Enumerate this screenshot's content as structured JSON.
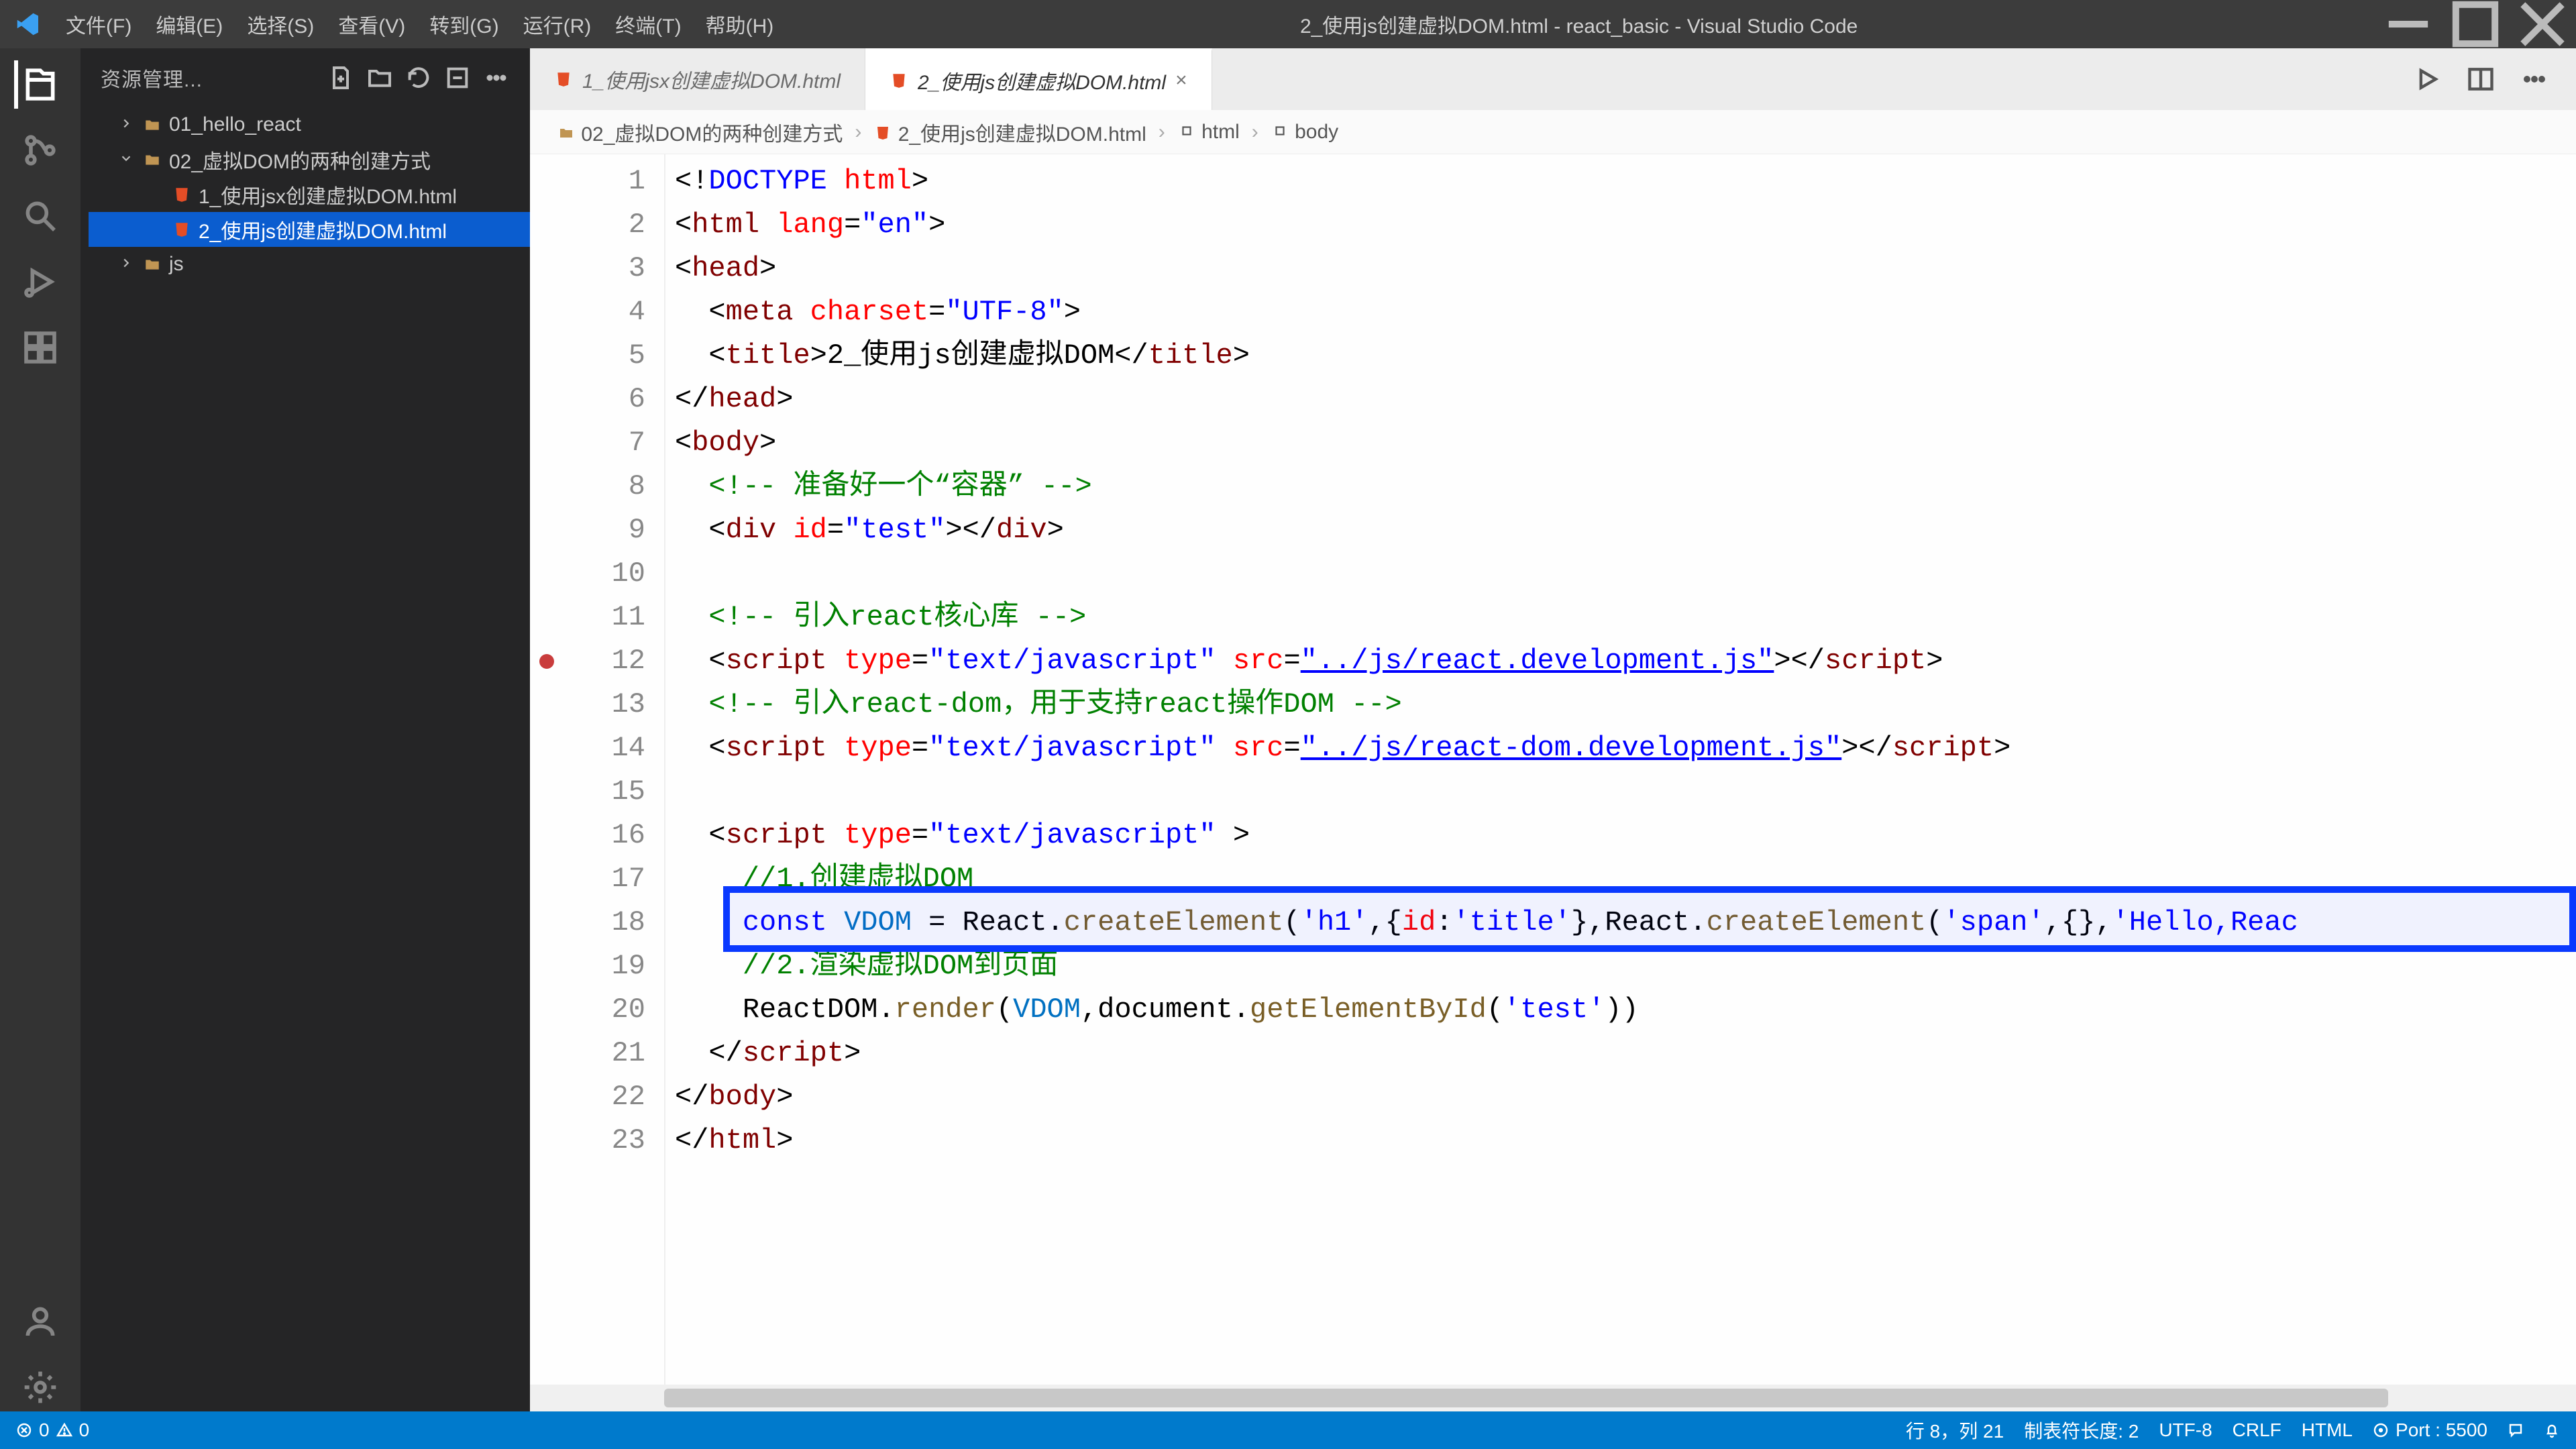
{
  "title": "2_使用js创建虚拟DOM.html - react_basic - Visual Studio Code",
  "menu": {
    "file": "文件(F)",
    "edit": "编辑(E)",
    "select": "选择(S)",
    "view": "查看(V)",
    "goto": "转到(G)",
    "run": "运行(R)",
    "terminal": "终端(T)",
    "help": "帮助(H)"
  },
  "sidebar": {
    "title": "资源管理...",
    "tree": [
      {
        "label": "01_hello_react",
        "kind": "folder",
        "indent": 1,
        "expanded": false
      },
      {
        "label": "02_虚拟DOM的两种创建方式",
        "kind": "folder",
        "indent": 1,
        "expanded": true
      },
      {
        "label": "1_使用jsx创建虚拟DOM.html",
        "kind": "html",
        "indent": 2
      },
      {
        "label": "2_使用js创建虚拟DOM.html",
        "kind": "html",
        "indent": 2,
        "selected": true
      },
      {
        "label": "js",
        "kind": "folder",
        "indent": 1,
        "expanded": false
      }
    ]
  },
  "tabs": [
    {
      "label": "1_使用jsx创建虚拟DOM.html",
      "active": false
    },
    {
      "label": "2_使用js创建虚拟DOM.html",
      "active": true
    }
  ],
  "breadcrumbs": [
    "02_虚拟DOM的两种创建方式",
    "2_使用js创建虚拟DOM.html",
    "html",
    "body"
  ],
  "code": {
    "lines": [
      {
        "n": 1,
        "seg": [
          {
            "c": "txt",
            "t": "<!"
          },
          {
            "c": "kw",
            "t": "DOCTYPE"
          },
          {
            "c": "txt",
            "t": " "
          },
          {
            "c": "attr",
            "t": "html"
          },
          {
            "c": "txt",
            "t": ">"
          }
        ]
      },
      {
        "n": 2,
        "seg": [
          {
            "c": "txt",
            "t": "<"
          },
          {
            "c": "tag",
            "t": "html"
          },
          {
            "c": "txt",
            "t": " "
          },
          {
            "c": "attr",
            "t": "lang"
          },
          {
            "c": "txt",
            "t": "="
          },
          {
            "c": "str",
            "t": "\"en\""
          },
          {
            "c": "txt",
            "t": ">"
          }
        ]
      },
      {
        "n": 3,
        "seg": [
          {
            "c": "txt",
            "t": "<"
          },
          {
            "c": "tag",
            "t": "head"
          },
          {
            "c": "txt",
            "t": ">"
          }
        ]
      },
      {
        "n": 4,
        "seg": [
          {
            "c": "txt",
            "t": "  <"
          },
          {
            "c": "tag",
            "t": "meta"
          },
          {
            "c": "txt",
            "t": " "
          },
          {
            "c": "attr",
            "t": "charset"
          },
          {
            "c": "txt",
            "t": "="
          },
          {
            "c": "str",
            "t": "\"UTF-8\""
          },
          {
            "c": "txt",
            "t": ">"
          }
        ]
      },
      {
        "n": 5,
        "seg": [
          {
            "c": "txt",
            "t": "  <"
          },
          {
            "c": "tag",
            "t": "title"
          },
          {
            "c": "txt",
            "t": ">2_使用js创建虚拟DOM</"
          },
          {
            "c": "tag",
            "t": "title"
          },
          {
            "c": "txt",
            "t": ">"
          }
        ]
      },
      {
        "n": 6,
        "seg": [
          {
            "c": "txt",
            "t": "</"
          },
          {
            "c": "tag",
            "t": "head"
          },
          {
            "c": "txt",
            "t": ">"
          }
        ]
      },
      {
        "n": 7,
        "seg": [
          {
            "c": "txt",
            "t": "<"
          },
          {
            "c": "tag",
            "t": "body"
          },
          {
            "c": "txt",
            "t": ">"
          }
        ]
      },
      {
        "n": 8,
        "seg": [
          {
            "c": "cmt",
            "t": "  <!-- 准备好一个“容器” -->"
          }
        ]
      },
      {
        "n": 9,
        "seg": [
          {
            "c": "txt",
            "t": "  <"
          },
          {
            "c": "tag",
            "t": "div"
          },
          {
            "c": "txt",
            "t": " "
          },
          {
            "c": "attr",
            "t": "id"
          },
          {
            "c": "txt",
            "t": "="
          },
          {
            "c": "str",
            "t": "\"test\""
          },
          {
            "c": "txt",
            "t": "></"
          },
          {
            "c": "tag",
            "t": "div"
          },
          {
            "c": "txt",
            "t": ">"
          }
        ]
      },
      {
        "n": 10,
        "seg": [
          {
            "c": "txt",
            "t": ""
          }
        ]
      },
      {
        "n": 11,
        "seg": [
          {
            "c": "cmt",
            "t": "  <!-- 引入react核心库 -->"
          }
        ]
      },
      {
        "n": 12,
        "bp": true,
        "seg": [
          {
            "c": "txt",
            "t": "  <"
          },
          {
            "c": "tag",
            "t": "script"
          },
          {
            "c": "txt",
            "t": " "
          },
          {
            "c": "attr",
            "t": "type"
          },
          {
            "c": "txt",
            "t": "="
          },
          {
            "c": "str",
            "t": "\"text/javascript\""
          },
          {
            "c": "txt",
            "t": " "
          },
          {
            "c": "attr",
            "t": "src"
          },
          {
            "c": "txt",
            "t": "="
          },
          {
            "c": "str und",
            "t": "\"../js/react.development.js\""
          },
          {
            "c": "txt",
            "t": "></"
          },
          {
            "c": "tag",
            "t": "script"
          },
          {
            "c": "txt",
            "t": ">"
          }
        ]
      },
      {
        "n": 13,
        "seg": [
          {
            "c": "cmt",
            "t": "  <!-- 引入react-dom，用于支持react操作DOM -->"
          }
        ]
      },
      {
        "n": 14,
        "seg": [
          {
            "c": "txt",
            "t": "  <"
          },
          {
            "c": "tag",
            "t": "script"
          },
          {
            "c": "txt",
            "t": " "
          },
          {
            "c": "attr",
            "t": "type"
          },
          {
            "c": "txt",
            "t": "="
          },
          {
            "c": "str",
            "t": "\"text/javascript\""
          },
          {
            "c": "txt",
            "t": " "
          },
          {
            "c": "attr",
            "t": "src"
          },
          {
            "c": "txt",
            "t": "="
          },
          {
            "c": "str und",
            "t": "\"../js/react-dom.development.js\""
          },
          {
            "c": "txt",
            "t": "></"
          },
          {
            "c": "tag",
            "t": "script"
          },
          {
            "c": "txt",
            "t": ">"
          }
        ]
      },
      {
        "n": 15,
        "seg": [
          {
            "c": "txt",
            "t": ""
          }
        ]
      },
      {
        "n": 16,
        "seg": [
          {
            "c": "txt",
            "t": "  <"
          },
          {
            "c": "tag",
            "t": "script"
          },
          {
            "c": "txt",
            "t": " "
          },
          {
            "c": "attr",
            "t": "type"
          },
          {
            "c": "txt",
            "t": "="
          },
          {
            "c": "str",
            "t": "\"text/javascript\""
          },
          {
            "c": "txt",
            "t": " >"
          }
        ]
      },
      {
        "n": 17,
        "seg": [
          {
            "c": "cmt",
            "t": "    //1.创建虚拟DOM"
          }
        ]
      },
      {
        "n": 18,
        "hl": true,
        "seg": [
          {
            "c": "txt",
            "t": "    "
          },
          {
            "c": "kw",
            "t": "const"
          },
          {
            "c": "txt",
            "t": " "
          },
          {
            "c": "varc",
            "t": "VDOM"
          },
          {
            "c": "txt",
            "t": " = React."
          },
          {
            "c": "fn",
            "t": "createElement"
          },
          {
            "c": "txt",
            "t": "("
          },
          {
            "c": "str",
            "t": "'h1'"
          },
          {
            "c": "txt",
            "t": ",{"
          },
          {
            "c": "attr",
            "t": "id"
          },
          {
            "c": "txt",
            "t": ":"
          },
          {
            "c": "str",
            "t": "'title'"
          },
          {
            "c": "txt",
            "t": "},React."
          },
          {
            "c": "fn",
            "t": "createElement"
          },
          {
            "c": "txt",
            "t": "("
          },
          {
            "c": "str",
            "t": "'span'"
          },
          {
            "c": "txt",
            "t": ",{},"
          },
          {
            "c": "str",
            "t": "'Hello,Reac"
          }
        ]
      },
      {
        "n": 19,
        "seg": [
          {
            "c": "cmt",
            "t": "    //2.渲染虚拟DOM到页面"
          }
        ]
      },
      {
        "n": 20,
        "seg": [
          {
            "c": "txt",
            "t": "    ReactDOM."
          },
          {
            "c": "fn",
            "t": "render"
          },
          {
            "c": "txt",
            "t": "("
          },
          {
            "c": "varc",
            "t": "VDOM"
          },
          {
            "c": "txt",
            "t": ",document."
          },
          {
            "c": "fn",
            "t": "getElementById"
          },
          {
            "c": "txt",
            "t": "("
          },
          {
            "c": "str",
            "t": "'test'"
          },
          {
            "c": "txt",
            "t": "))"
          }
        ]
      },
      {
        "n": 21,
        "seg": [
          {
            "c": "txt",
            "t": "  </"
          },
          {
            "c": "tag",
            "t": "script"
          },
          {
            "c": "txt",
            "t": ">"
          }
        ]
      },
      {
        "n": 22,
        "seg": [
          {
            "c": "txt",
            "t": "</"
          },
          {
            "c": "tag",
            "t": "body"
          },
          {
            "c": "txt",
            "t": ">"
          }
        ]
      },
      {
        "n": 23,
        "seg": [
          {
            "c": "txt",
            "t": "</"
          },
          {
            "c": "tag",
            "t": "html"
          },
          {
            "c": "txt",
            "t": ">"
          }
        ]
      }
    ]
  },
  "status": {
    "errors": "0",
    "warnings": "0",
    "cursor": "行 8，列 21",
    "tab": "制表符长度: 2",
    "encoding": "UTF-8",
    "eol": "CRLF",
    "lang": "HTML",
    "port": "Port : 5500"
  }
}
